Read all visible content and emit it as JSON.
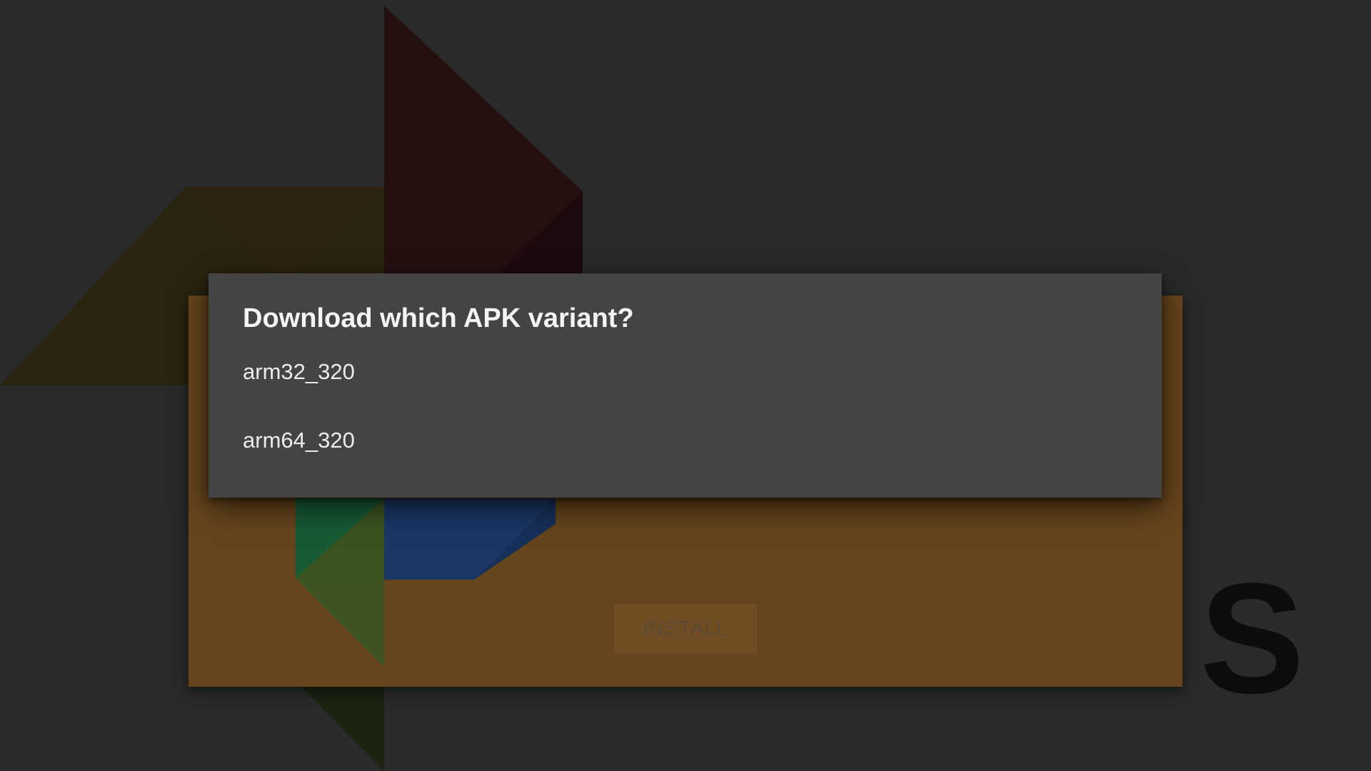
{
  "dialog": {
    "title": "Download which APK variant?",
    "options": [
      {
        "label": "arm32_320"
      },
      {
        "label": "arm64_320"
      }
    ]
  },
  "install_card": {
    "button_label": "INSTALL",
    "background_color": "#66451c"
  },
  "background": {
    "logo_icon": "pinwheel-logo-icon",
    "wordmark_visible_fragment": "S"
  },
  "colors": {
    "dialog_background": "#444444",
    "screen_background": "#2a2a2a",
    "dialog_text": "#f4f4f4"
  }
}
